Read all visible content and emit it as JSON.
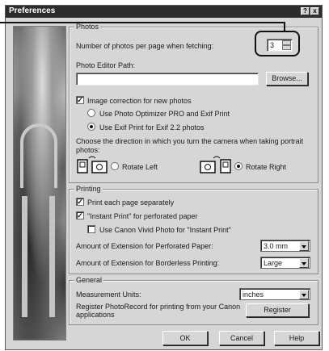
{
  "window": {
    "title": "Preferences",
    "help_glyph": "?",
    "close_glyph": "x"
  },
  "photos": {
    "legend": "Photos",
    "photos_per_page_label": "Number of photos per page when fetching:",
    "photos_per_page_value": "3",
    "editor_path_label": "Photo Editor Path:",
    "editor_path_value": "",
    "browse_label": "Browse...",
    "image_correction_label": "Image correction for new photos",
    "image_correction_checked": true,
    "option_optimizer_label": "Use Photo Optimizer PRO and Exif Print",
    "option_exif_label": "Use Exif Print for Exif 2.2 photos",
    "selected_option": "exif",
    "direction_label": "Choose the direction in which you turn the camera when taking portrait photos:",
    "rotate_left_label": "Rotate Left",
    "rotate_right_label": "Rotate Right",
    "selected_rotation": "right"
  },
  "printing": {
    "legend": "Printing",
    "print_each_label": "Print each page separately",
    "print_each_checked": true,
    "instant_print_label": "\"Instant Print\" for perforated paper",
    "instant_print_checked": true,
    "vivid_label": "Use Canon Vivid Photo for \"Instant Print\"",
    "vivid_checked": false,
    "extension_perforated_label": "Amount of Extension for Perforated Paper:",
    "extension_perforated_value": "3.0 mm",
    "extension_borderless_label": "Amount of Extension for Borderless Printing:",
    "extension_borderless_value": "Large"
  },
  "general": {
    "legend": "General",
    "units_label": "Measurement Units:",
    "units_value": "inches",
    "register_text_line1": "Register PhotoRecord for printing from your Canon",
    "register_text_line2": "applications",
    "register_button": "Register"
  },
  "footer": {
    "ok_label": "OK",
    "cancel_label": "Cancel",
    "help_label": "Help"
  }
}
